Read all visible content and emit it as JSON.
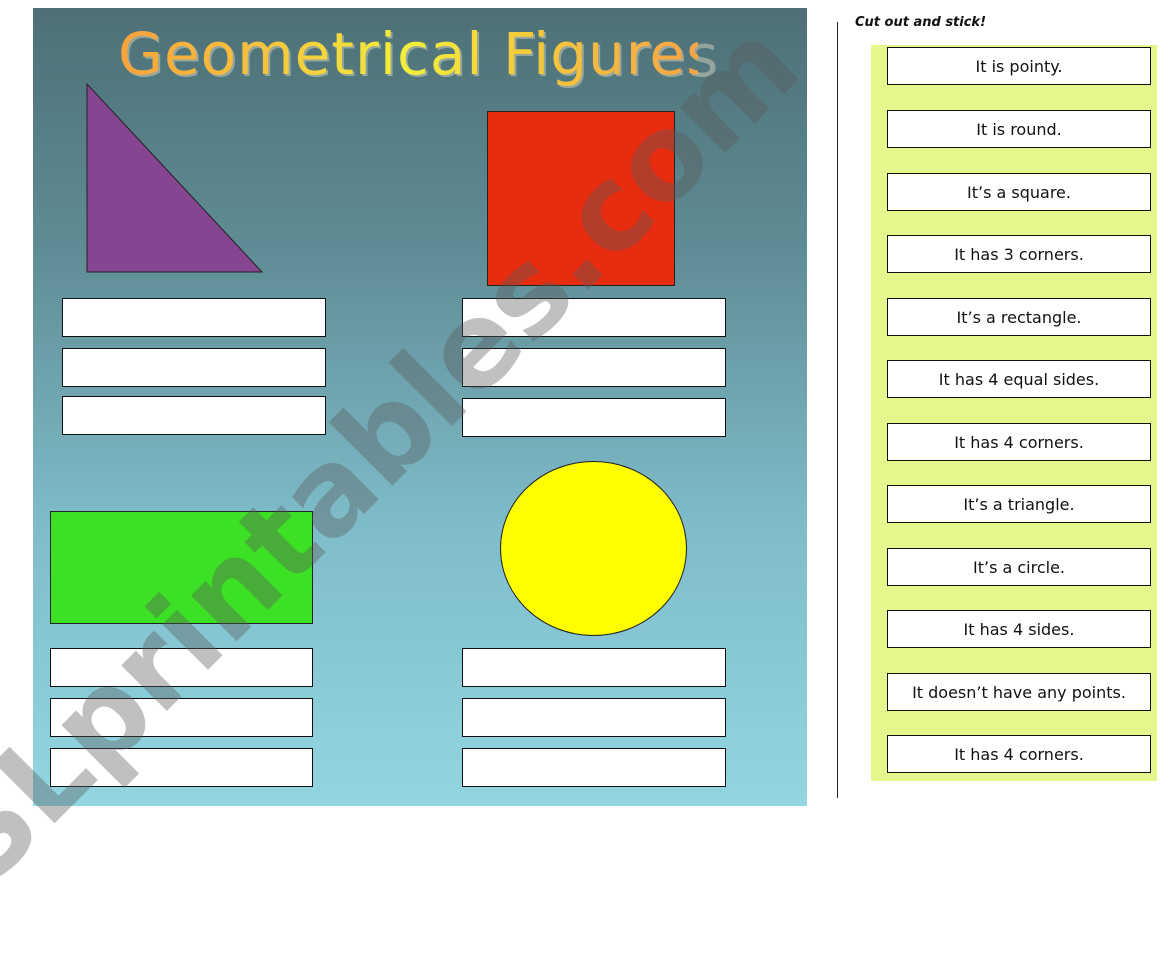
{
  "worksheet": {
    "title": "Geometrical Figures",
    "watermark": "ESLprintables.com",
    "background_colors": {
      "top": "#4d7076",
      "bottom": "#92d6e2"
    },
    "shapes": [
      {
        "name": "triangle",
        "color": "#864590",
        "answer_boxes": 3
      },
      {
        "name": "square",
        "color": "#e82c10",
        "answer_boxes": 3
      },
      {
        "name": "rectangle",
        "color": "#3ce024",
        "answer_boxes": 3
      },
      {
        "name": "circle",
        "color": "#ffff00",
        "answer_boxes": 3
      }
    ],
    "answer_box_values": [
      "",
      "",
      "",
      "",
      "",
      "",
      "",
      "",
      "",
      "",
      "",
      ""
    ]
  },
  "cutout": {
    "instruction": "Cut out and stick!",
    "panel_color": "#e6f68c",
    "cards": [
      "It is pointy.",
      "It is round.",
      "It’s a square.",
      "It has 3 corners.",
      "It’s a rectangle.",
      "It has 4 equal sides.",
      "It has 4 corners.",
      "It’s a triangle.",
      "It’s a circle.",
      "It has 4 sides.",
      "It doesn’t have any points.",
      "It has 4 corners."
    ]
  }
}
